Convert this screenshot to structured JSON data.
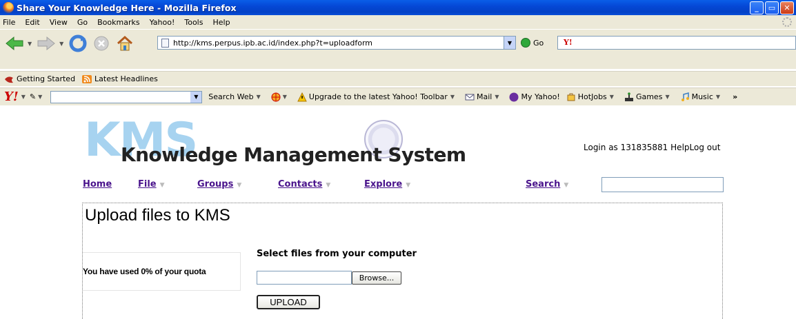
{
  "window": {
    "title": "Share Your Knowledge Here - Mozilla Firefox"
  },
  "menu": {
    "items": [
      "File",
      "Edit",
      "View",
      "Go",
      "Bookmarks",
      "Yahoo!",
      "Tools",
      "Help"
    ]
  },
  "nav": {
    "url": "http://kms.perpus.ipb.ac.id/index.php?t=uploadform",
    "go_label": "Go"
  },
  "bookmarks": {
    "items": [
      "Getting Started",
      "Latest Headlines"
    ]
  },
  "yahoo_toolbar": {
    "logo": "Y!",
    "search_web": "Search Web",
    "upgrade": "Upgrade to the latest Yahoo! Toolbar",
    "mail": "Mail",
    "my_yahoo": "My Yahoo!",
    "hotjobs": "HotJobs",
    "games": "Games",
    "music": "Music",
    "more": "»"
  },
  "site": {
    "logo_letters": "KMS",
    "title": "Knowledge Management System",
    "login_text": "Login as 131835881",
    "help": "Help",
    "logout": "Log out",
    "nav": {
      "home": "Home",
      "file": "File",
      "groups": "Groups",
      "contacts": "Contacts",
      "explore": "Explore",
      "search": "Search"
    },
    "search_value": ""
  },
  "upload": {
    "heading": "Upload files to KMS",
    "quota_text": "You have used 0% of your quota",
    "select_label": "Select files from your computer",
    "file_value": "",
    "browse_label": "Browse...",
    "upload_label": "UPLOAD"
  },
  "colors": {
    "title_bar": "#0548d6",
    "nav_link": "#4a148c",
    "logo_light_blue": "#a7d3f0"
  }
}
